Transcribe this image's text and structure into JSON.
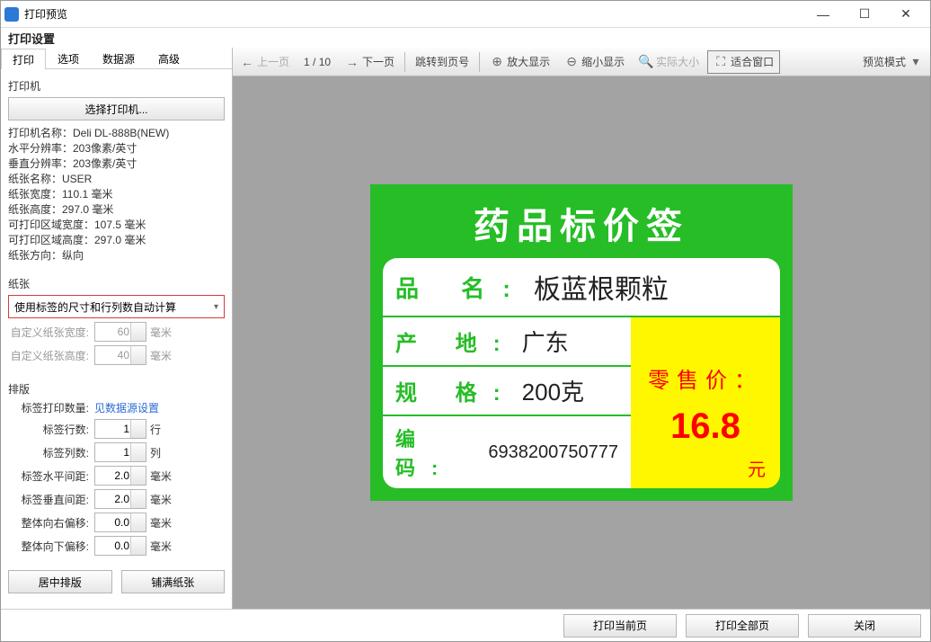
{
  "window": {
    "title": "打印预览"
  },
  "settings_title": "打印设置",
  "tabs": [
    "打印",
    "选项",
    "数据源",
    "高级"
  ],
  "printer": {
    "section": "打印机",
    "select_btn": "选择打印机...",
    "info": [
      "打印机名称：Deli DL-888B(NEW)",
      "水平分辨率：203像素/英寸",
      "垂直分辨率：203像素/英寸",
      "纸张名称：USER",
      "纸张宽度：110.1 毫米",
      "纸张高度：297.0 毫米",
      "可打印区域宽度：107.5 毫米",
      "可打印区域高度：297.0 毫米",
      "纸张方向：纵向"
    ]
  },
  "paper": {
    "section": "纸张",
    "mode": "使用标签的尺寸和行列数自动计算",
    "custom_w_label": "自定义纸张宽度:",
    "custom_w": "60",
    "custom_h_label": "自定义纸张高度:",
    "custom_h": "40",
    "unit": "毫米"
  },
  "layout": {
    "section": "排版",
    "count_label": "标签打印数量:",
    "count_link": "见数据源设置",
    "fields": [
      {
        "label": "标签行数:",
        "value": "1",
        "unit": "行"
      },
      {
        "label": "标签列数:",
        "value": "1",
        "unit": "列"
      },
      {
        "label": "标签水平间距:",
        "value": "2.0",
        "unit": "毫米"
      },
      {
        "label": "标签垂直间距:",
        "value": "2.0",
        "unit": "毫米"
      },
      {
        "label": "整体向右偏移:",
        "value": "0.0",
        "unit": "毫米"
      },
      {
        "label": "整体向下偏移:",
        "value": "0.0",
        "unit": "毫米"
      }
    ],
    "btn_center": "居中排版",
    "btn_fill": "铺满纸张"
  },
  "toolbar": {
    "prev": "上一页",
    "pos": "1 / 10",
    "next": "下一页",
    "goto": "跳转到页号",
    "zoomin": "放大显示",
    "zoomout": "缩小显示",
    "actual": "实际大小",
    "fit": "适合窗口",
    "mode": "预览模式"
  },
  "label": {
    "title": "药品标价签",
    "name_k": "品 名:",
    "name_v": "板蓝根颗粒",
    "origin_k": "产 地:",
    "origin_v": "广东",
    "spec_k": "规 格:",
    "spec_v": "200克",
    "code_k": "编 码:",
    "code_v": "6938200750777",
    "price_k": "零售价：",
    "price_v": "16.8",
    "price_u": "元"
  },
  "footer": {
    "print_current": "打印当前页",
    "print_all": "打印全部页",
    "close": "关闭"
  }
}
